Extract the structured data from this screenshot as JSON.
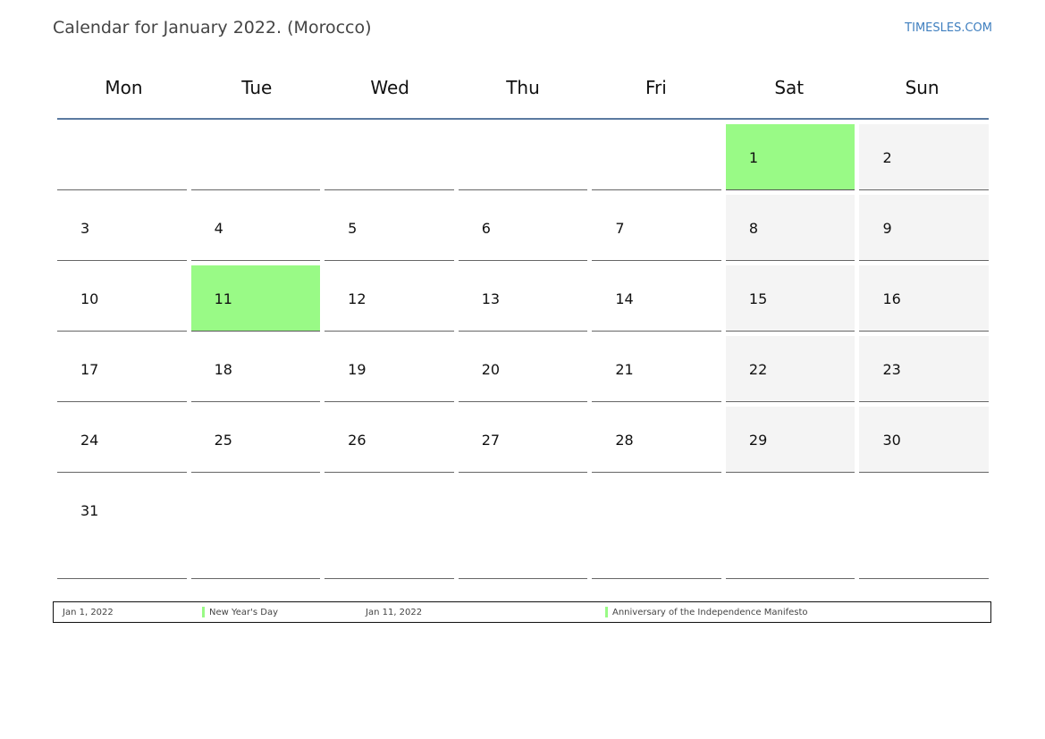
{
  "header": {
    "title": "Calendar for January 2022. (Morocco)",
    "site": "TIMESLES.COM"
  },
  "weekdays": [
    "Mon",
    "Tue",
    "Wed",
    "Thu",
    "Fri",
    "Sat",
    "Sun"
  ],
  "weeks": [
    [
      "",
      "",
      "",
      "",
      "",
      "1",
      "2"
    ],
    [
      "3",
      "4",
      "5",
      "6",
      "7",
      "8",
      "9"
    ],
    [
      "10",
      "11",
      "12",
      "13",
      "14",
      "15",
      "16"
    ],
    [
      "17",
      "18",
      "19",
      "20",
      "21",
      "22",
      "23"
    ],
    [
      "24",
      "25",
      "26",
      "27",
      "28",
      "29",
      "30"
    ],
    [
      "31",
      "",
      "",
      "",
      "",
      "",
      ""
    ]
  ],
  "holiday_days": [
    "1",
    "11"
  ],
  "colors": {
    "holiday": "#99fa86",
    "weekend": "#f4f4f4",
    "header_rule": "#5b7aa0",
    "link": "#3f7fbf"
  },
  "legend": [
    {
      "date": "Jan 1, 2022",
      "name": "New Year's Day"
    },
    {
      "date": "Jan 11, 2022",
      "name": "Anniversary of the Independence Manifesto"
    }
  ]
}
